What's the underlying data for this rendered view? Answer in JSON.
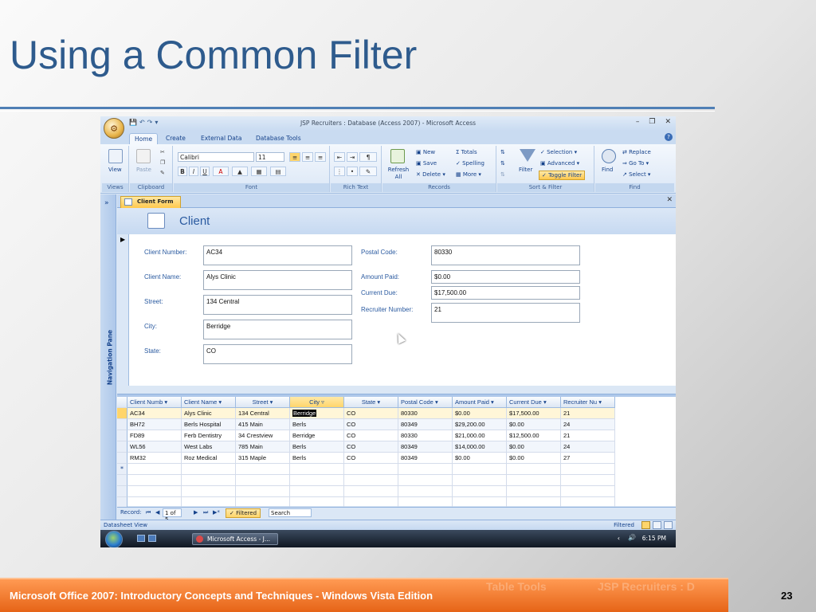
{
  "slide": {
    "title": "Using a Common Filter",
    "footer": "Microsoft Office 2007: Introductory Concepts and Techniques - Windows Vista Edition",
    "page_number": "23"
  },
  "window": {
    "title": "JSP Recruiters : Database (Access 2007) - Microsoft Access",
    "tabs": [
      "Home",
      "Create",
      "External Data",
      "Database Tools"
    ],
    "active_tab": "Home"
  },
  "ribbon": {
    "groups": [
      "Views",
      "Clipboard",
      "Font",
      "Rich Text",
      "Records",
      "Sort & Filter",
      "Find"
    ],
    "view_label": "View",
    "paste_label": "Paste",
    "font_name": "Calibri",
    "font_size": "11",
    "refresh_label": "Refresh All",
    "new_label": "New",
    "save_label": "Save",
    "delete_label": "Delete",
    "totals_label": "Totals",
    "spelling_label": "Spelling",
    "more_label": "More",
    "filter_label": "Filter",
    "selection_label": "Selection",
    "advanced_label": "Advanced",
    "toggle_filter_label": "Toggle Filter",
    "find_label": "Find",
    "replace_label": "Replace",
    "goto_label": "Go To",
    "select_label": "Select"
  },
  "nav_pane_label": "Navigation Pane",
  "document_tab": "Client Form",
  "form": {
    "title": "Client",
    "left_fields": [
      {
        "label": "Client Number:",
        "value": "AC34"
      },
      {
        "label": "Client Name:",
        "value": "Alys Clinic"
      },
      {
        "label": "Street:",
        "value": "134 Central"
      },
      {
        "label": "City:",
        "value": "Berridge"
      },
      {
        "label": "State:",
        "value": "CO"
      }
    ],
    "right_fields": [
      {
        "label": "Postal Code:",
        "value": "80330"
      },
      {
        "label": "Amount Paid:",
        "value": "$0.00"
      },
      {
        "label": "Current Due:",
        "value": "$17,500.00"
      },
      {
        "label": "Recruiter Number:",
        "value": "21"
      }
    ]
  },
  "datasheet": {
    "columns": [
      "Client Numb",
      "Client Name",
      "Street",
      "City",
      "State",
      "Postal Code",
      "Amount Paid",
      "Current Due",
      "Recruiter Nu"
    ],
    "rows": [
      [
        "AC34",
        "Alys Clinic",
        "134 Central",
        "Berridge",
        "CO",
        "80330",
        "$0.00",
        "$17,500.00",
        "21"
      ],
      [
        "BH72",
        "Berls Hospital",
        "415 Main",
        "Berls",
        "CO",
        "80349",
        "$29,200.00",
        "$0.00",
        "24"
      ],
      [
        "FD89",
        "Ferb Dentistry",
        "34 Crestview",
        "Berridge",
        "CO",
        "80330",
        "$21,000.00",
        "$12,500.00",
        "21"
      ],
      [
        "WL56",
        "West Labs",
        "785 Main",
        "Berls",
        "CO",
        "80349",
        "$14,000.00",
        "$0.00",
        "24"
      ],
      [
        "RM32",
        "Roz Medical",
        "315 Maple",
        "Berls",
        "CO",
        "80349",
        "$0.00",
        "$0.00",
        "27"
      ]
    ],
    "new_row_marker": "*"
  },
  "record_nav": {
    "label": "Record:",
    "position": "1 of 5",
    "filter_status": "Filtered",
    "search": "Search"
  },
  "status_bar": {
    "left": "Datasheet View",
    "right": "Filtered"
  },
  "taskbar": {
    "app": "Microsoft Access - J...",
    "time": "6:15 PM"
  },
  "colors": {
    "title_blue": "#2e5b8d",
    "footer_orange": "#f07a2a",
    "filter_highlight": "#ffd56b"
  }
}
